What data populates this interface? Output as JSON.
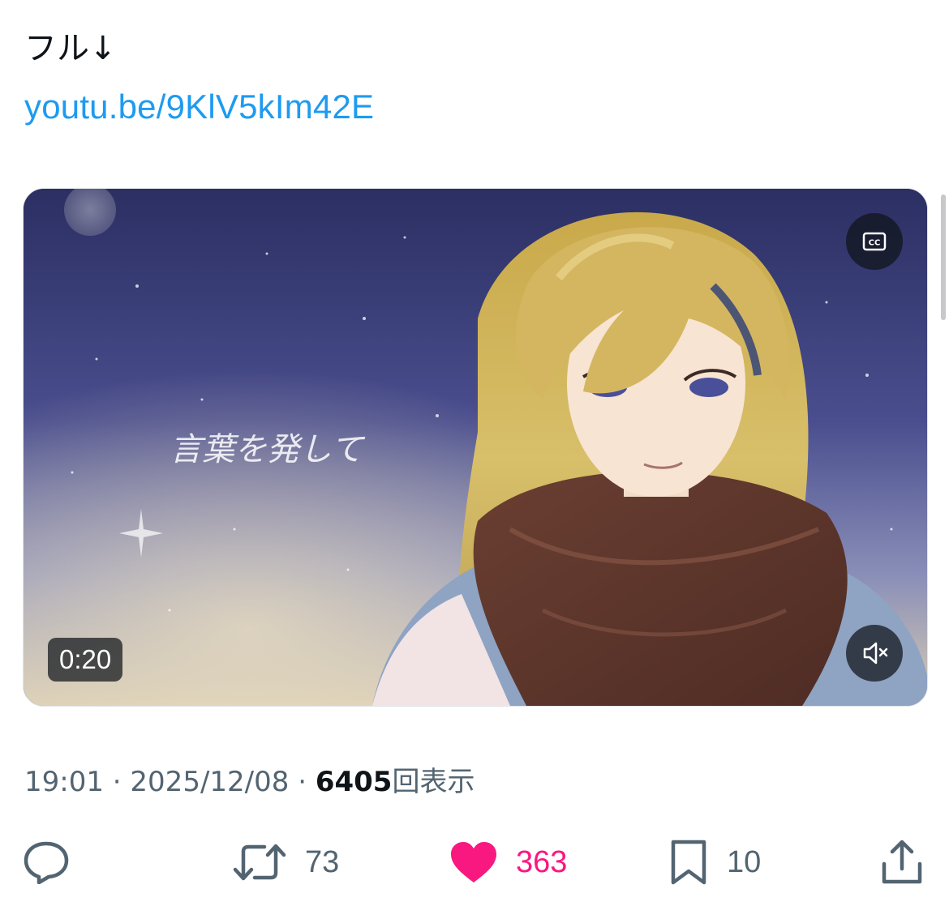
{
  "tweet": {
    "text": "フル↓",
    "link": "youtu.be/9KlV5kIm42E"
  },
  "media": {
    "duration": "0:20",
    "overlay_text": "言葉を発して",
    "cc_icon": "closed-captions-icon",
    "mute_icon": "speaker-muted-icon"
  },
  "meta": {
    "time": "19:01",
    "separator": " · ",
    "date": "2025/12/08",
    "views_count": "6405",
    "views_label": "回表示"
  },
  "actions": {
    "reply": {
      "icon": "reply-icon",
      "count": ""
    },
    "retweet": {
      "icon": "retweet-icon",
      "count": "73"
    },
    "like": {
      "icon": "heart-icon",
      "count": "363"
    },
    "bookmark": {
      "icon": "bookmark-icon",
      "count": "10"
    },
    "share": {
      "icon": "share-icon",
      "count": ""
    }
  },
  "colors": {
    "link": "#1d9bf0",
    "like_active": "#f91880",
    "secondary_text": "#536471",
    "primary_text": "#0f1419"
  }
}
